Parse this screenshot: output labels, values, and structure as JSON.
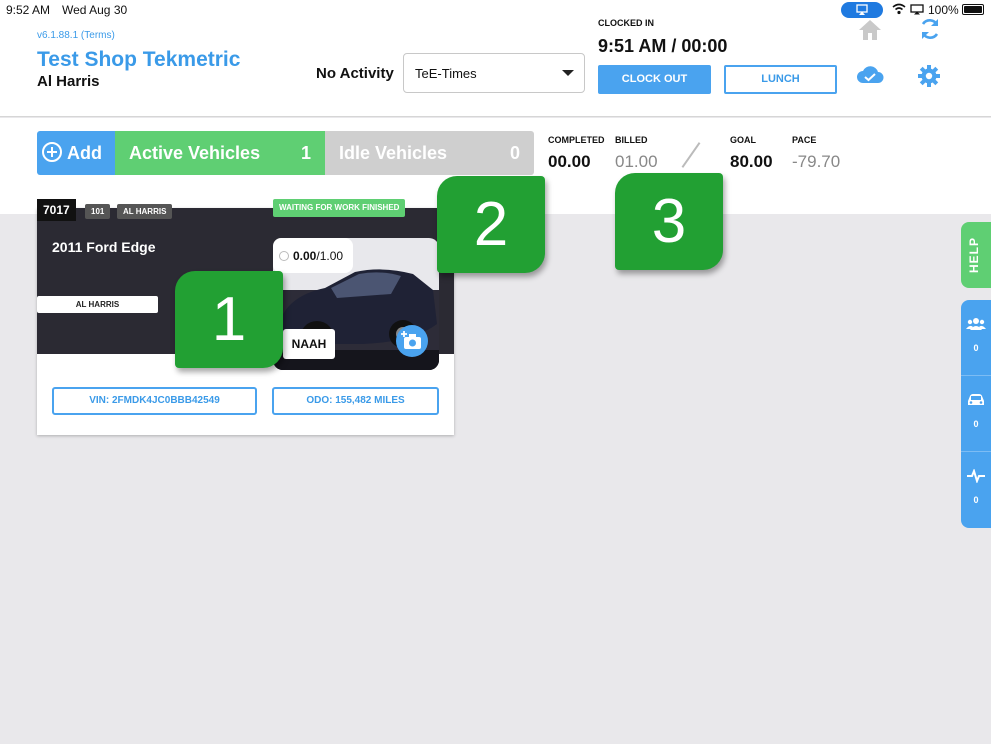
{
  "statusbar": {
    "time": "9:52 AM",
    "date": "Wed Aug 30",
    "battery": "100%"
  },
  "header": {
    "version": "v6.1.88.1 (Terms)",
    "shop_name": "Test Shop Tekmetric",
    "user_name": "Al Harris",
    "activity_label": "No Activity",
    "activity_select_value": "TeE-Times",
    "clocked_in_label": "CLOCKED IN",
    "clocked_in_time": "9:51 AM / 00:00",
    "clock_out_label": "CLOCK OUT",
    "lunch_label": "LUNCH"
  },
  "tabs": {
    "add_label": "Add",
    "active_label": "Active Vehicles",
    "active_count": "1",
    "idle_label": "Idle Vehicles",
    "idle_count": "0"
  },
  "stats": {
    "completed_label": "COMPLETED",
    "completed_value": "00.00",
    "billed_label": "BILLED",
    "billed_value": "01.00",
    "goal_label": "GOAL",
    "goal_value": "80.00",
    "pace_label": "PACE",
    "pace_value": "-79.70"
  },
  "card": {
    "ro_number": "7017",
    "tag_number": "101",
    "tag_tech": "AL HARRIS",
    "status": "WAITING FOR WORK FINISHED",
    "vehicle": "2011 Ford Edge",
    "tech_pill": "AL HARRIS",
    "hours_value": "0.00",
    "hours_total": "/1.00",
    "plate_tag": "NAAH",
    "vin": "VIN: 2FMDK4JC0BBB42549",
    "odo": "ODO: 155,482 MILES"
  },
  "callouts": {
    "one": "1",
    "two": "2",
    "three": "3"
  },
  "sidebar": {
    "help_label": "HELP",
    "customers_count": "0",
    "vehicles_count": "0",
    "activity_count": "0"
  },
  "colors": {
    "accent_blue": "#4aa3ef",
    "active_green": "#5fcf73",
    "callout_green": "#22a033",
    "idle_gray": "#cfcfcf"
  }
}
